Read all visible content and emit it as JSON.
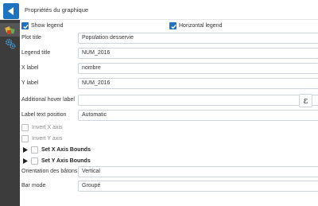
{
  "header": {
    "title": "Propriétés du graphique"
  },
  "sidebar": {
    "tabs": [
      {
        "name": "chart-style",
        "icon": "palette-icon",
        "active": true
      },
      {
        "name": "advanced",
        "icon": "gears-icon",
        "active": false
      }
    ]
  },
  "checkboxes_top": {
    "show_legend": {
      "label": "Show legend",
      "checked": true
    },
    "horizontal_legend": {
      "label": "Horizontal legend",
      "checked": true
    }
  },
  "fields": {
    "plot_title": {
      "label": "Plot title",
      "value": "Population desservie"
    },
    "legend_title": {
      "label": "Legend title",
      "value": "NUM_2016"
    },
    "x_label": {
      "label": "X label",
      "value": "nombre"
    },
    "y_label": {
      "label": "Y label",
      "value": "NUM_2016"
    },
    "hover_label": {
      "label": "Additional hover label",
      "value": ""
    },
    "label_position": {
      "label": "Label text position",
      "value": "Automatic"
    }
  },
  "axis_options": {
    "invert_x": {
      "label": "Invert X axis",
      "checked": false
    },
    "invert_y": {
      "label": "Invert Y axis",
      "checked": false
    },
    "x_bounds": {
      "label": "Set X Axis Bounds",
      "checked": false
    },
    "y_bounds": {
      "label": "Set Y Axis Bounds",
      "checked": false
    }
  },
  "orientation": {
    "label": "Orientation des bâtons",
    "value": "Vertical"
  },
  "bar_mode": {
    "label": "Bar mode",
    "value": "Groupé"
  },
  "expression_button": {
    "glyph": "ε"
  },
  "colors": {
    "accent": "#1e73be",
    "sidebar": "#3c3c3c",
    "sidebar_active": "#555555"
  }
}
